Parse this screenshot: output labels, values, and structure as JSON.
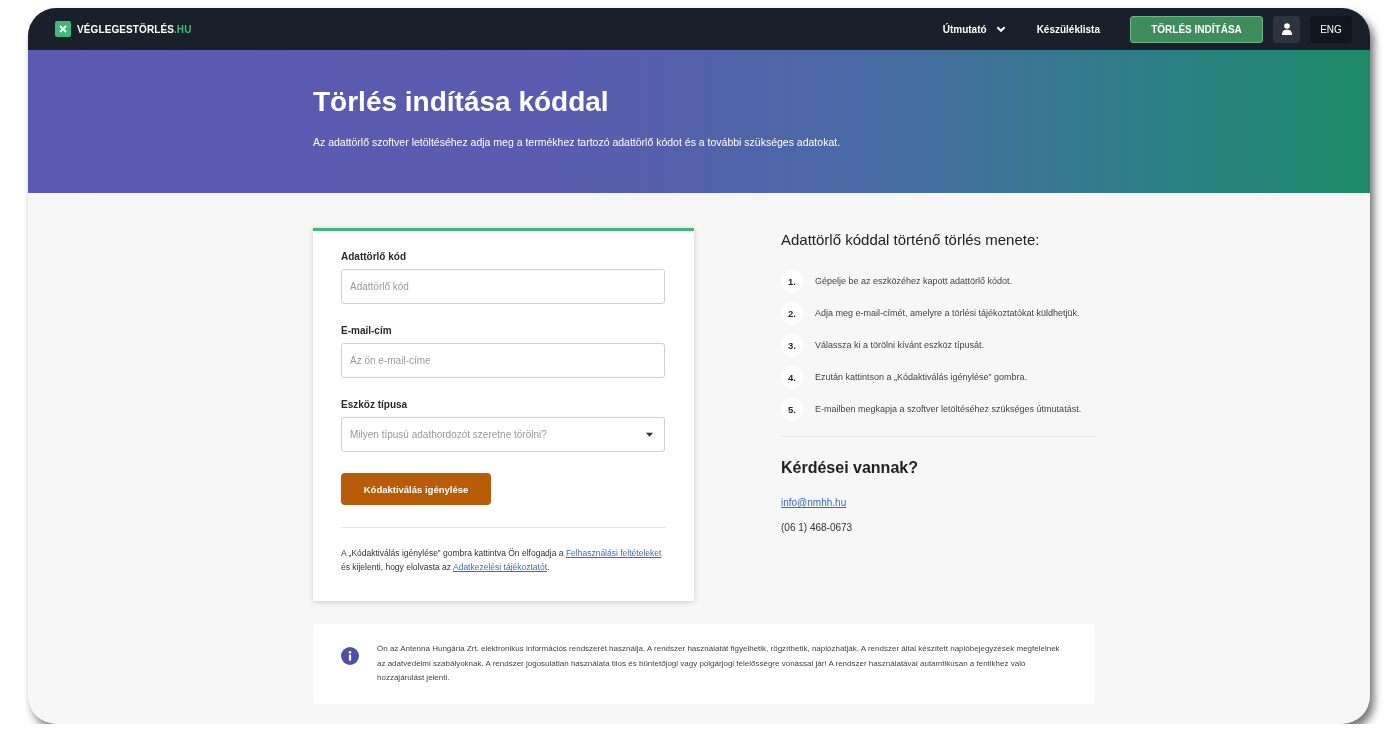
{
  "nav": {
    "logo": {
      "name": "VÉGLEGESTÖRLÉS",
      "suffix": ".HU"
    },
    "links": [
      {
        "label": "Útmutató",
        "kind": "dropdown"
      },
      {
        "label": "Készüléklista",
        "kind": "link"
      }
    ],
    "cta": "TÖRLÉS INDÍTÁSA",
    "language": "ENG"
  },
  "hero": {
    "title": "Törlés indítása kóddal",
    "subtitle": "Az adattörlő szoftver letöltéséhez adja meg a termékhez tartozó adattörlő kódot és a további szükséges adatokat."
  },
  "form": {
    "fields": [
      {
        "label": "Adattörlő kód",
        "placeholder": "Adattörlő kód",
        "kind": "text"
      },
      {
        "label": "E-mail-cím",
        "placeholder": "Az ön e-mail-címe",
        "kind": "text"
      },
      {
        "label": "Eszköz típusa",
        "placeholder": "Milyen típusú adathordozót szeretne törölni?",
        "kind": "select"
      }
    ],
    "submit": "Kódaktiválás igénylése",
    "consent": [
      {
        "kind": "text",
        "text": "A „Kódaktiválás igénylése” gombra kattintva Ön elfogadja a "
      },
      {
        "kind": "link",
        "text": "Felhasználási feltételeket"
      },
      {
        "kind": "text",
        "text": " és kijelenti, hogy elolvasta az "
      },
      {
        "kind": "link",
        "text": "Adatkezelési tájékoztatót"
      },
      {
        "kind": "text",
        "text": "."
      }
    ]
  },
  "steps": {
    "title": "Adattörlő kóddal történő törlés menete:",
    "items": [
      {
        "number": "1.",
        "text": "Gépelje be az eszközéhez kapott adattörlő kódot."
      },
      {
        "number": "2.",
        "text": "Adja meg e-mail-címét, amelyre a törlési tájékoztatókat küldhetjük."
      },
      {
        "number": "3.",
        "text": "Válassza ki a törölni kívánt eszköz típusát."
      },
      {
        "number": "4.",
        "text": "Ezután kattintson a „Kódaktiválás igénylése” gombra."
      },
      {
        "number": "5.",
        "text": "E-mailben megkapja a szoftver letöltéséhez szükséges útmutatást."
      }
    ]
  },
  "contact": {
    "title": "Kérdései vannak?",
    "email": "info@nmhh.hu",
    "phone": "(06 1) 468-0673"
  },
  "notice": "Ön az Antenna Hungária Zrt. elektronikus információs rendszerét használja. A rendszer használatát figyelhetik, rögzíthetik, naplózhatják. A rendszer által készített naplóbejegyzések megfelelnek az adatvédelmi szabályoknak. A rendszer jogosulatlan használata tilos és büntetőjogi vagy polgárjogi felelősségre vonással jár! A rendszer használatával autamtikusan a fentikhez való hozzájárulást jelenti."
}
